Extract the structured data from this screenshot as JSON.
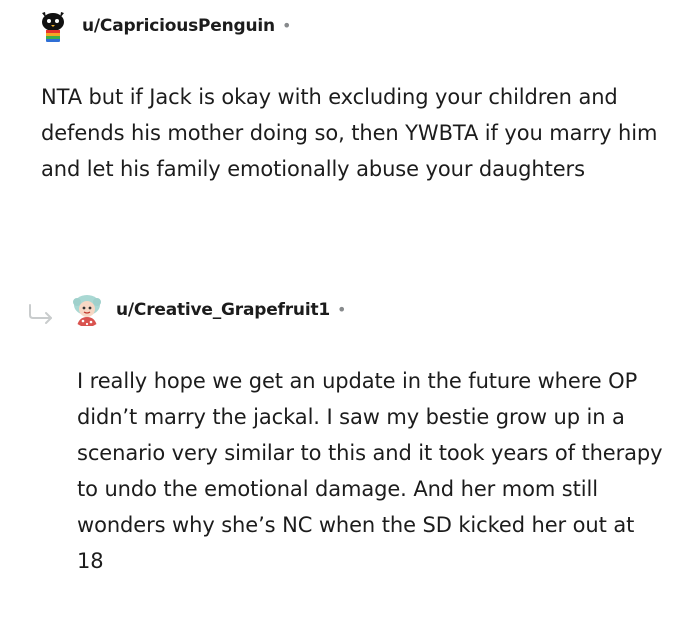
{
  "comments": [
    {
      "username": "u/CapriciousPenguin",
      "separator": "•",
      "avatar": "penguin-avatar-icon",
      "body": "NTA but if Jack is okay with excluding your children and defends his mother doing so, then YWBTA if you marry him and let his family emotionally abuse your daughters"
    },
    {
      "username": "u/Creative_Grapefruit1",
      "separator": "•",
      "avatar": "grapefruit-avatar-icon",
      "body": "I really hope we get an update in the future where OP didn’t marry the jackal. I saw my bestie grow up in a scenario very similar to this and it took years of therapy to undo the emotional damage. And her mom still wonders why she’s NC when the SD kicked her out at 18"
    }
  ],
  "colors": {
    "text": "#1c1c1c",
    "muted": "#878a8c",
    "reply_arrow": "#c9cccd"
  },
  "icons": {
    "reply_arrow": "reply-arrow-icon"
  }
}
